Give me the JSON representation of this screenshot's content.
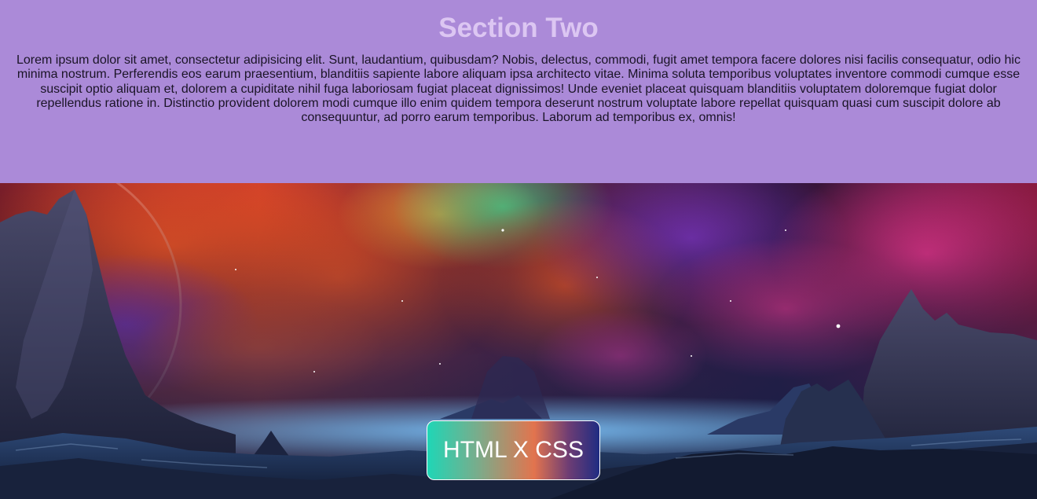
{
  "section": {
    "title": "Section Two",
    "body": "Lorem ipsum dolor sit amet, consectetur adipisicing elit. Sunt, laudantium, quibusdam? Nobis, delectus, commodi, fugit amet tempora facere dolores nisi facilis consequatur, odio hic minima nostrum. Perferendis eos earum praesentium, blanditiis sapiente labore aliquam ipsa architecto vitae. Minima soluta temporibus voluptates inventore commodi cumque esse suscipit optio aliquam et, dolorem a cupiditate nihil fuga laboriosam fugiat placeat dignissimos! Unde eveniet placeat quisquam blanditiis voluptatem doloremque fugiat dolor repellendus ratione in. Distinctio provident dolorem modi cumque illo enim quidem tempora deserunt nostrum voluptate labore repellat quisquam quasi cum suscipit dolore ab consequuntur, ad porro earum temporibus. Laborum ad temporibus ex, omnis!"
  },
  "hero": {
    "button_label": "HTML X CSS"
  },
  "colors": {
    "section_background": "#ab8ad8",
    "title_color": "#dcc6f2",
    "body_text": "#1a1426",
    "button_gradient": [
      "#1fd6b6",
      "#e2744e",
      "#1f2c82"
    ]
  }
}
